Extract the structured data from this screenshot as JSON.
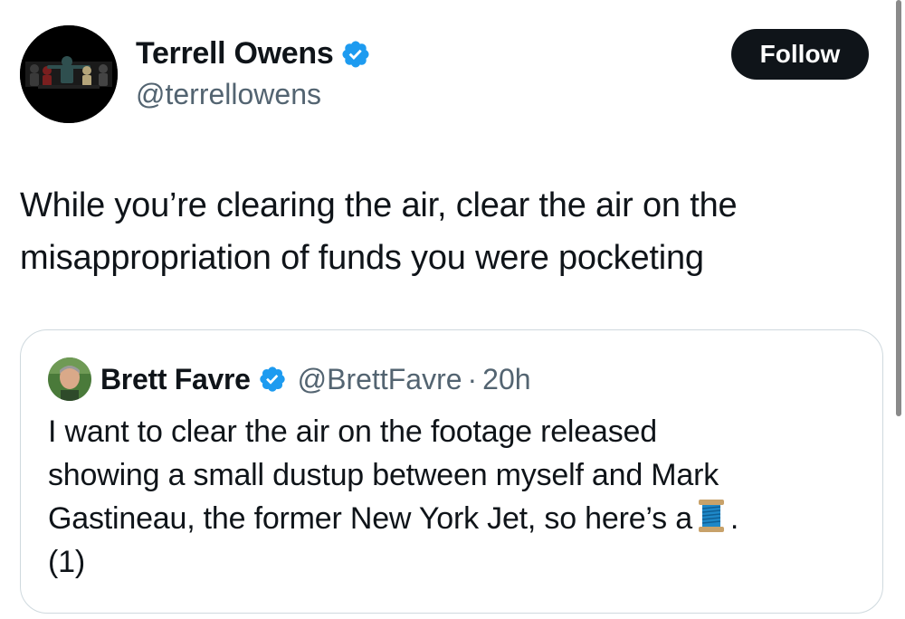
{
  "author": {
    "display_name": "Terrell Owens",
    "handle": "@terrellowens",
    "verified": true,
    "avatar": "football-players-collage-avatar"
  },
  "follow_button": {
    "label": "Follow"
  },
  "tweet": {
    "line1": "While you’re clearing the air, clear the air on the",
    "line2": "misappropriation of funds you were pocketing"
  },
  "quoted_tweet": {
    "display_name": "Brett Favre",
    "handle": "@BrettFavre",
    "separator": "·",
    "time": "20h",
    "verified": true,
    "avatar": "brett-favre-portrait-avatar",
    "text_line1": "I want to clear the air on the footage released",
    "text_line2": "showing a small dustup between myself and Mark",
    "text_line3_before_emoji": "Gastineau, the former New York Jet, so here’s a",
    "emoji": "spool-of-thread-emoji",
    "text_line3_after_emoji": ".",
    "text_line4": "(1)"
  },
  "colors": {
    "verified_blue": "#1d9bf0",
    "text_primary": "#0f1419",
    "text_secondary": "#536471",
    "border": "#cfd9de",
    "follow_bg": "#0f1419"
  }
}
